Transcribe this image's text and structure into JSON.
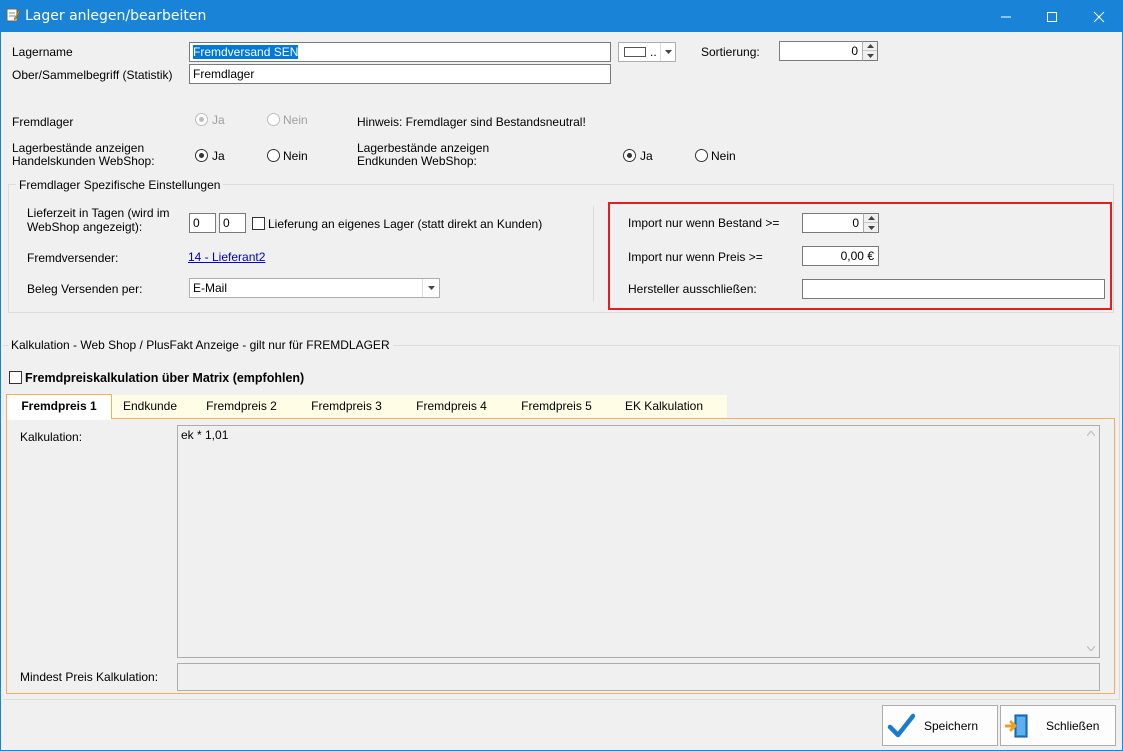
{
  "window": {
    "title": "Lager anlegen/bearbeiten"
  },
  "form": {
    "lagername_label": "Lagername",
    "lagername_value": "Fremdversand SEN",
    "color_button": "..",
    "sortierung_label": "Sortierung:",
    "sortierung_value": "0",
    "oberbegriff_label": "Ober/Sammelbegriff (Statistik)",
    "oberbegriff_value": "Fremdlager",
    "fremdlager_label": "Fremdlager",
    "ja": "Ja",
    "nein": "Nein",
    "hinweis": "Hinweis: Fremdlager sind Bestandsneutral!",
    "handelskunden_label_1": "Lagerbestände anzeigen",
    "handelskunden_label_2": "Handelskunden WebShop:",
    "endkunden_label_1": "Lagerbestände anzeigen",
    "endkunden_label_2": "Endkunden WebShop:"
  },
  "group_fremdlager": {
    "title": "Fremdlager Spezifische Einstellungen",
    "lieferzeit_label_1": "Lieferzeit in Tagen (wird im",
    "lieferzeit_label_2": "WebShop angezeigt):",
    "lieferzeit_von": "0",
    "lieferzeit_bis": "0",
    "lieferung_eigenes_lager": "Lieferung an eigenes Lager (statt direkt an Kunden)",
    "fremdversender_label": "Fremdversender:",
    "fremdversender_value": "14 - Lieferant2",
    "beleg_label": "Beleg Versenden per:",
    "beleg_value": "E-Mail",
    "import_bestand_label": "Import nur wenn Bestand >=",
    "import_bestand_value": "0",
    "import_preis_label": "Import nur wenn Preis >=",
    "import_preis_value": "0,00 €",
    "hersteller_label": "Hersteller ausschließen:",
    "hersteller_value": ""
  },
  "kalkulation": {
    "title": "Kalkulation - Web Shop / PlusFakt Anzeige - gilt nur für FREMDLAGER",
    "matrix_label": "Fremdpreiskalkulation über Matrix (empfohlen)",
    "tabs": [
      {
        "label": "Fremdpreis 1"
      },
      {
        "label": "Endkunde"
      },
      {
        "label": "Fremdpreis 2"
      },
      {
        "label": "Fremdpreis 3"
      },
      {
        "label": "Fremdpreis 4"
      },
      {
        "label": "Fremdpreis 5"
      },
      {
        "label": "EK Kalkulation"
      }
    ],
    "kalkulation_label": "Kalkulation:",
    "kalkulation_value": "ek * 1,01",
    "mindest_label": "Mindest Preis Kalkulation:",
    "mindest_value": ""
  },
  "buttons": {
    "speichern": "Speichern",
    "schliessen": "Schließen"
  },
  "colors": {
    "titlebar": "#1883d7",
    "highlight_box": "#e02020",
    "tab_border": "#f0b060"
  }
}
